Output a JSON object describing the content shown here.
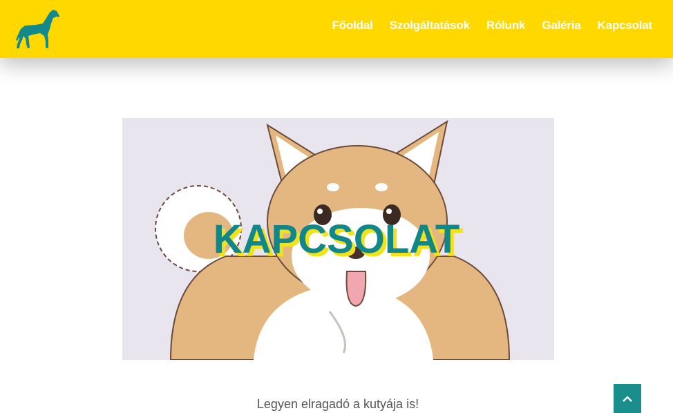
{
  "header": {
    "logo_icon": "greyhound-dog-logo",
    "nav": [
      {
        "label": "Főoldal"
      },
      {
        "label": "Szolgáltatások"
      },
      {
        "label": "Rólunk"
      },
      {
        "label": "Galéria"
      },
      {
        "label": "Kapcsolat"
      }
    ]
  },
  "hero": {
    "image": "shiba-inu-illustration",
    "title": "KAPCSOLAT"
  },
  "content": {
    "tagline": "Legyen elragadó a kutyája is!"
  },
  "scroll_top": {
    "icon": "chevron-up-icon"
  },
  "colors": {
    "header_bg": "#ffd800",
    "accent": "#11878a",
    "title_shadow": "#f0e21c"
  }
}
